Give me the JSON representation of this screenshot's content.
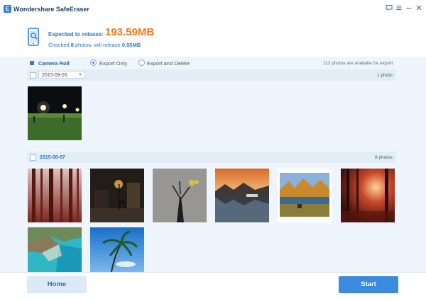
{
  "app": {
    "title": "Wondershare SafeEraser",
    "logo_letter": "E"
  },
  "window_controls": [
    "feedback-icon",
    "menu-icon",
    "minimize-icon",
    "close-icon"
  ],
  "header": {
    "expected_label": "Expected to release:",
    "expected_size": "193.59MB",
    "checked_prefix": "Checked",
    "checked_count": "8",
    "checked_mid": "photos, will release",
    "release_size": "0.55MB"
  },
  "options": {
    "section": "Camera Roll",
    "export_only": "Export Only",
    "export_delete": "Export and Delete",
    "selected": "export_only",
    "summary": "112 photos are availabe for export."
  },
  "groups": [
    {
      "date": "2015-09-26",
      "count": "1 photo",
      "photos": [
        "night-soccer-field"
      ]
    },
    {
      "date": "2015-08-07",
      "count": "8 photos",
      "photos": [
        "red-forest",
        "deer-street-night",
        "tree-owl-art",
        "lake-mountains-sunset",
        "autumn-lake",
        "sunlit-forest",
        "coast-lagoon",
        "palm-trees"
      ]
    }
  ],
  "buttons": {
    "home": "Home",
    "start": "Start"
  },
  "colors": {
    "accent": "#2f7fd9",
    "highlight": "#f07a1a",
    "content_bg": "#eef5fc",
    "start_bg": "#3a8ae0"
  }
}
